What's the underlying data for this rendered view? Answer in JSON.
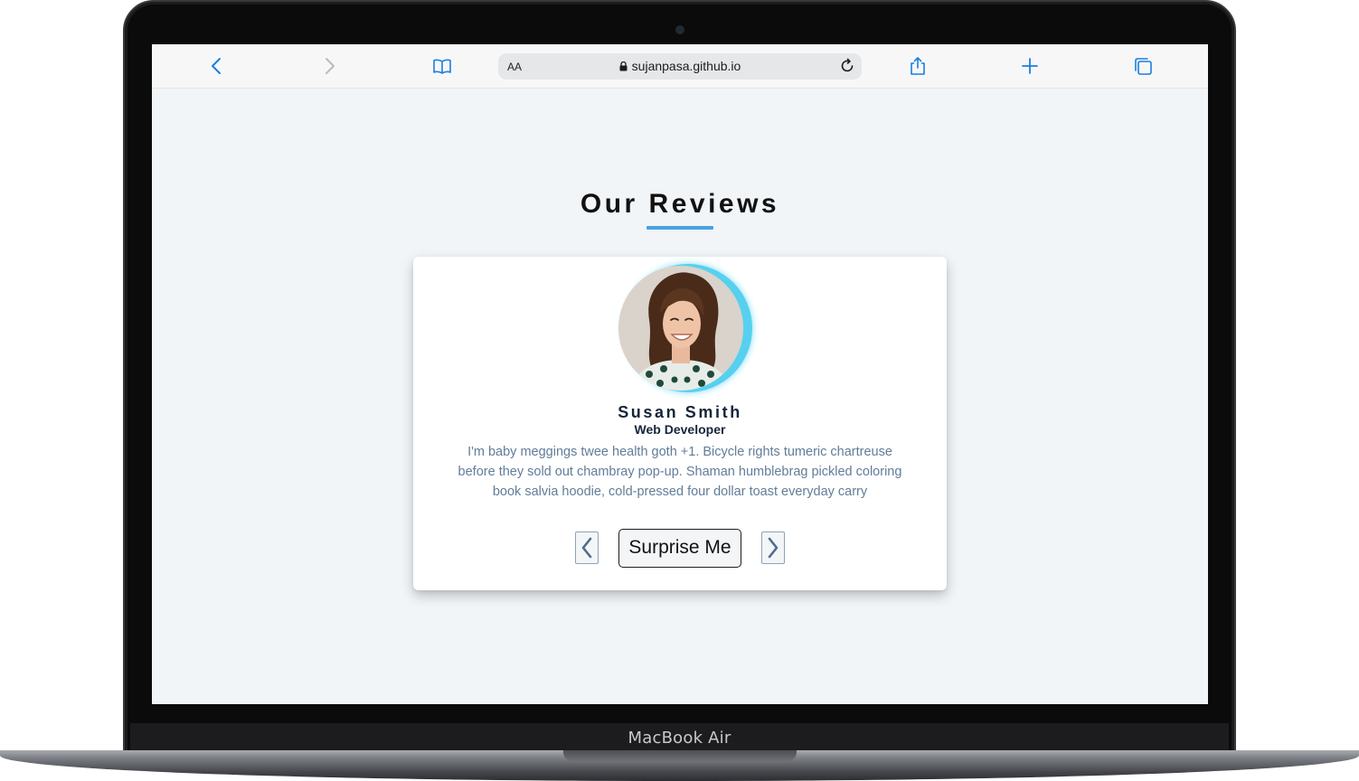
{
  "device": {
    "brand_label": "MacBook Air"
  },
  "browser": {
    "text_size_label": "AA",
    "url": "sujanpasa.github.io",
    "icons": [
      "back-icon",
      "forward-icon",
      "bookmarks-icon",
      "lock-icon",
      "reload-icon",
      "share-icon",
      "new-tab-icon",
      "tabs-icon"
    ]
  },
  "page": {
    "title": "Our Reviews",
    "accent_color": "#49a3dd",
    "review": {
      "name": "Susan Smith",
      "job": "Web Developer",
      "text": "I'm baby meggings twee health goth +1. Bicycle rights tumeric chartreuse before they sold out chambray pop-up. Shaman humblebrag pickled coloring book salvia hoodie, cold-pressed four dollar toast everyday carry",
      "surprise_label": "Surprise Me"
    }
  }
}
